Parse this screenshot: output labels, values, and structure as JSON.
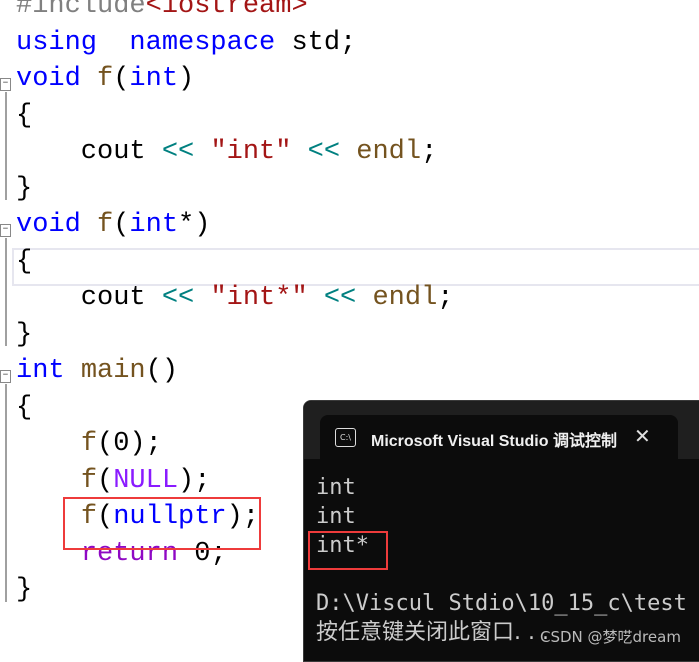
{
  "code": {
    "lines": [
      {
        "parts": [
          [
            "pp",
            "#include"
          ],
          [
            "str",
            "<iostream>"
          ]
        ]
      },
      {
        "parts": [
          [
            "kw",
            "using"
          ],
          [
            "",
            "  "
          ],
          [
            "kw",
            "namespace"
          ],
          [
            "",
            " std;"
          ]
        ]
      },
      {
        "parts": [
          [
            "kw",
            "void"
          ],
          [
            "",
            " "
          ],
          [
            "fn",
            "f"
          ],
          [
            "",
            "("
          ],
          [
            "kw",
            "int"
          ],
          [
            "",
            ")"
          ]
        ]
      },
      {
        "parts": [
          [
            "",
            "{"
          ]
        ]
      },
      {
        "parts": [
          [
            "",
            "    cout "
          ],
          [
            "op",
            "<<"
          ],
          [
            "",
            " "
          ],
          [
            "str",
            "\"int\""
          ],
          [
            "",
            " "
          ],
          [
            "op",
            "<<"
          ],
          [
            "",
            " "
          ],
          [
            "fn",
            "endl"
          ],
          [
            "",
            ";"
          ]
        ]
      },
      {
        "parts": [
          [
            "",
            "}"
          ]
        ]
      },
      {
        "parts": [
          [
            "kw",
            "void"
          ],
          [
            "",
            " "
          ],
          [
            "fn",
            "f"
          ],
          [
            "",
            "("
          ],
          [
            "kw",
            "int"
          ],
          [
            "",
            "*)"
          ]
        ]
      },
      {
        "parts": [
          [
            "",
            "{"
          ]
        ]
      },
      {
        "parts": [
          [
            "",
            "    cout "
          ],
          [
            "op",
            "<<"
          ],
          [
            "",
            " "
          ],
          [
            "str",
            "\"int*\""
          ],
          [
            "",
            " "
          ],
          [
            "op",
            "<<"
          ],
          [
            "",
            " "
          ],
          [
            "fn",
            "endl"
          ],
          [
            "",
            ";"
          ]
        ]
      },
      {
        "parts": [
          [
            "",
            "}"
          ]
        ]
      },
      {
        "parts": [
          [
            "kw",
            "int"
          ],
          [
            "",
            " "
          ],
          [
            "fn",
            "main"
          ],
          [
            "",
            "()"
          ]
        ]
      },
      {
        "parts": [
          [
            "",
            "{"
          ]
        ]
      },
      {
        "parts": [
          [
            "",
            "    "
          ],
          [
            "fn",
            "f"
          ],
          [
            "",
            "(0);"
          ]
        ]
      },
      {
        "parts": [
          [
            "",
            "    "
          ],
          [
            "fn",
            "f"
          ],
          [
            "",
            "("
          ],
          [
            "mac",
            "NULL"
          ],
          [
            "",
            ");"
          ]
        ]
      },
      {
        "parts": [
          [
            "",
            "    "
          ],
          [
            "fn",
            "f"
          ],
          [
            "",
            "("
          ],
          [
            "kw",
            "nullptr"
          ],
          [
            "",
            ");"
          ]
        ]
      },
      {
        "parts": [
          [
            "",
            "    "
          ],
          [
            "ctl",
            "return"
          ],
          [
            "",
            " 0;"
          ]
        ]
      },
      {
        "parts": [
          [
            "",
            "}"
          ]
        ]
      }
    ]
  },
  "console": {
    "icon": "terminal-icon",
    "icon_text": "C:\\",
    "title": "Microsoft Visual Studio 调试控制台",
    "close": "✕",
    "output": [
      "int",
      "int",
      "int*",
      "",
      "D:\\Viscul Stdio\\10_15_c\\test",
      "按任意键关闭此窗口. . ."
    ]
  },
  "watermark": "CSDN @梦呓dream",
  "colors": {
    "highlight_box": "#ee3b3b",
    "keyword": "#0000ff",
    "string": "#a31515",
    "console_bg": "#0c0c0c"
  }
}
